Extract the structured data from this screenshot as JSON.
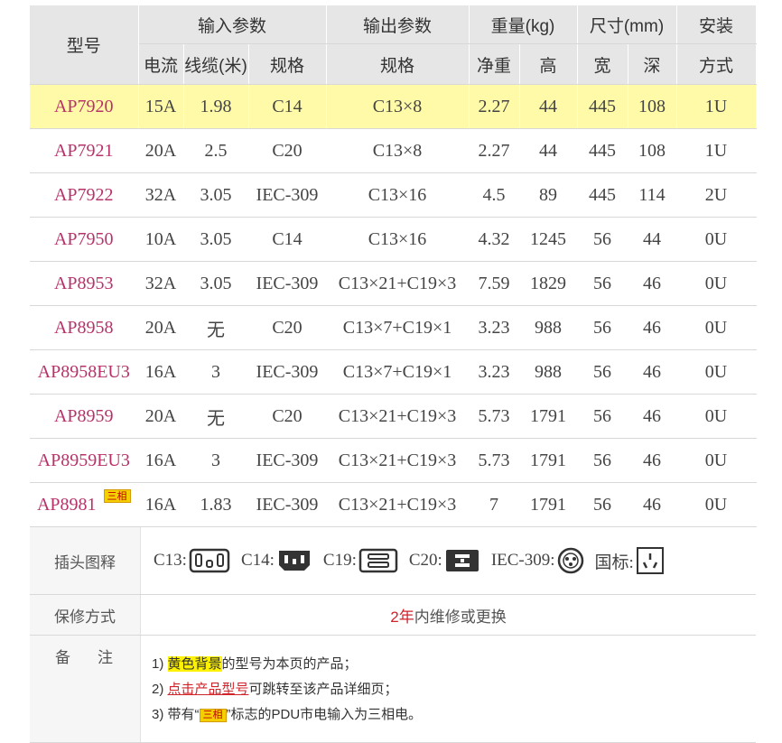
{
  "header": {
    "model": "型号",
    "input_params": "输入参数",
    "output_params": "输出参数",
    "weight": "重量(kg)",
    "size": "尺寸(mm)",
    "install_top": "安装",
    "install_bottom": "方式",
    "current": "电流",
    "cable": "线缆(米)",
    "spec_in": "规格",
    "spec_out": "规格",
    "net_weight": "净重",
    "height": "高",
    "width": "宽",
    "depth": "深"
  },
  "rows": [
    {
      "model": "AP7920",
      "current": "15A",
      "cable": "1.98",
      "in_spec": "C14",
      "out_spec": "C13×8",
      "weight": "2.27",
      "h": "44",
      "w": "445",
      "d": "108",
      "mount": "1U"
    },
    {
      "model": "AP7921",
      "current": "20A",
      "cable": "2.5",
      "in_spec": "C20",
      "out_spec": "C13×8",
      "weight": "2.27",
      "h": "44",
      "w": "445",
      "d": "108",
      "mount": "1U"
    },
    {
      "model": "AP7922",
      "current": "32A",
      "cable": "3.05",
      "in_spec": "IEC-309",
      "out_spec": "C13×16",
      "weight": "4.5",
      "h": "89",
      "w": "445",
      "d": "114",
      "mount": "2U"
    },
    {
      "model": "AP7950",
      "current": "10A",
      "cable": "3.05",
      "in_spec": "C14",
      "out_spec": "C13×16",
      "weight": "4.32",
      "h": "1245",
      "w": "56",
      "d": "44",
      "mount": "0U"
    },
    {
      "model": "AP8953",
      "current": "32A",
      "cable": "3.05",
      "in_spec": "IEC-309",
      "out_spec": "C13×21+C19×3",
      "weight": "7.59",
      "h": "1829",
      "w": "56",
      "d": "46",
      "mount": "0U"
    },
    {
      "model": "AP8958",
      "current": "20A",
      "cable": "无",
      "in_spec": "C20",
      "out_spec": "C13×7+C19×1",
      "weight": "3.23",
      "h": "988",
      "w": "56",
      "d": "46",
      "mount": "0U"
    },
    {
      "model": "AP8958EU3",
      "current": "16A",
      "cable": "3",
      "in_spec": "IEC-309",
      "out_spec": "C13×7+C19×1",
      "weight": "3.23",
      "h": "988",
      "w": "56",
      "d": "46",
      "mount": "0U"
    },
    {
      "model": "AP8959",
      "current": "20A",
      "cable": "无",
      "in_spec": "C20",
      "out_spec": "C13×21+C19×3",
      "weight": "5.73",
      "h": "1791",
      "w": "56",
      "d": "46",
      "mount": "0U"
    },
    {
      "model": "AP8959EU3",
      "current": "16A",
      "cable": "3",
      "in_spec": "IEC-309",
      "out_spec": "C13×21+C19×3",
      "weight": "5.73",
      "h": "1791",
      "w": "56",
      "d": "46",
      "mount": "0U"
    },
    {
      "model": "AP8981",
      "badge": "三相",
      "current": "16A",
      "cable": "1.83",
      "in_spec": "IEC-309",
      "out_spec": "C13×21+C19×3",
      "weight": "7",
      "h": "1791",
      "w": "56",
      "d": "46",
      "mount": "0U"
    }
  ],
  "highlight_color": "#fffaa8",
  "model_color": "#b8326a",
  "plugs": {
    "label": "插头图释",
    "items": [
      {
        "name": "C13:",
        "icon": "c13-plug-icon"
      },
      {
        "name": "C14:",
        "icon": "c14-plug-icon"
      },
      {
        "name": "C19:",
        "icon": "c19-plug-icon"
      },
      {
        "name": "C20:",
        "icon": "c20-plug-icon"
      },
      {
        "name": "IEC-309:",
        "icon": "iec309-plug-icon"
      },
      {
        "name": "国标:",
        "icon": "gb-plug-icon"
      }
    ]
  },
  "warranty": {
    "label": "保修方式",
    "years": "2年",
    "text": "内维修或更换"
  },
  "notes": {
    "label": "备注",
    "n1_prefix": "1) ",
    "n1_highlight": "黄色背景",
    "n1_rest": "的型号为本页的产品；",
    "n2_prefix": "2) ",
    "n2_link": "点击产品型号",
    "n2_rest": "可跳转至该产品详细页；",
    "n3_prefix": "3) 带有“",
    "n3_badge": "三相",
    "n3_rest": "”标志的PDU市电输入为三相电。"
  }
}
